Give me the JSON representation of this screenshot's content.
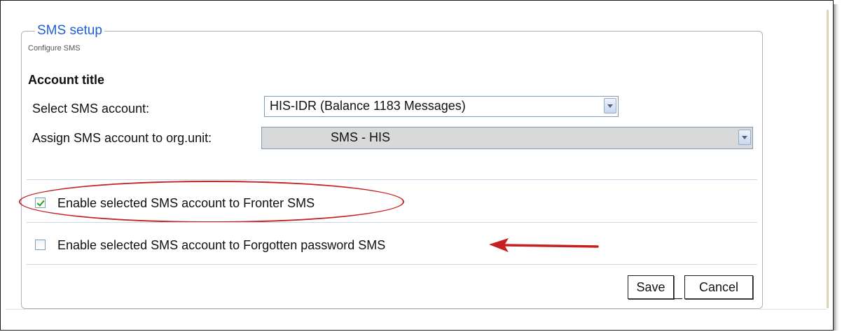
{
  "panel": {
    "title": "SMS setup",
    "subtitle": "Configure SMS"
  },
  "account": {
    "section_title": "Account title",
    "select_account_label": "Select SMS account:",
    "select_account_value": "HIS-IDR  (Balance 1183 Messages)",
    "assign_label": "Assign SMS account to org.unit:",
    "assign_value": "SMS - HIS"
  },
  "options": [
    {
      "label": "Enable selected SMS account to Fronter SMS",
      "checked": true
    },
    {
      "label": "Enable selected SMS account to Forgotten password SMS",
      "checked": false
    }
  ],
  "buttons": {
    "save": "Save",
    "cancel": "Cancel"
  },
  "annotation_colors": {
    "highlight": "#c62020",
    "arrow": "#c62020"
  }
}
